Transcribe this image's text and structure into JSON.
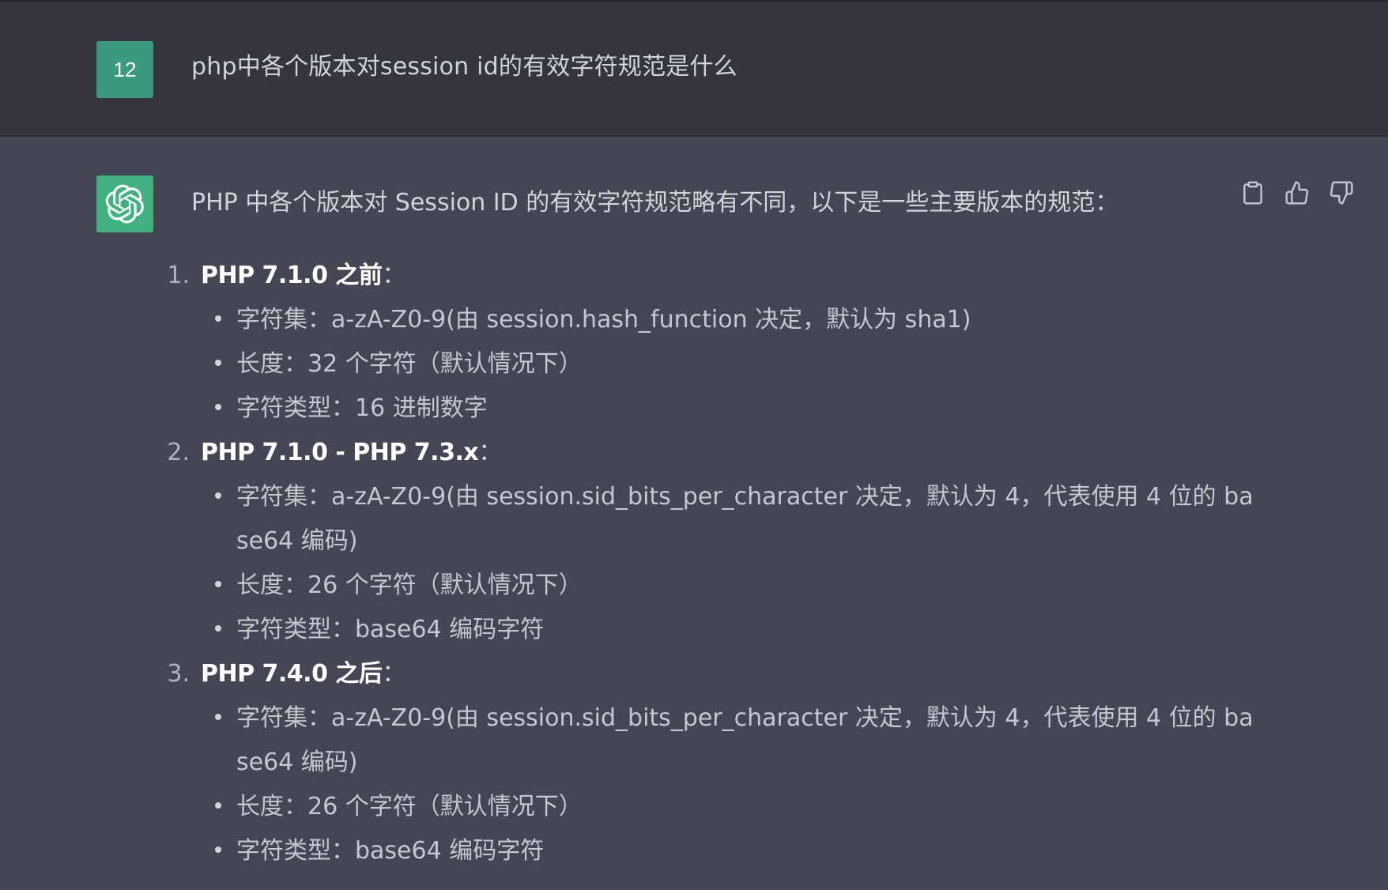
{
  "user_message": {
    "avatar_label": "12",
    "text": "php中各个版本对session id的有效字符规范是什么"
  },
  "assistant_message": {
    "avatar_icon": "openai-logo-icon",
    "intro": "PHP 中各个版本对 Session ID 的有效字符规范略有不同，以下是一些主要版本的规范：",
    "actions": {
      "copy": "copy-icon",
      "thumbs_up": "thumbs-up-icon",
      "thumbs_down": "thumbs-down-icon"
    },
    "sections": [
      {
        "number": "1.",
        "title": "PHP 7.1.0 之前",
        "colon": "：",
        "items": [
          "字符集：a-zA-Z0-9(由 session.hash_function 决定，默认为 sha1)",
          "长度：32 个字符（默认情况下）",
          "字符类型：16 进制数字"
        ]
      },
      {
        "number": "2.",
        "title": "PHP 7.1.0 - PHP 7.3.x",
        "colon": "：",
        "items": [
          "字符集：a-zA-Z0-9(由 session.sid_bits_per_character 决定，默认为 4，代表使用 4 位的 base64 编码)",
          "长度：26 个字符（默认情况下）",
          "字符类型：base64 编码字符"
        ]
      },
      {
        "number": "3.",
        "title": "PHP 7.4.0 之后",
        "colon": "：",
        "items": [
          "字符集：a-zA-Z0-9(由 session.sid_bits_per_character 决定，默认为 4，代表使用 4 位的 base64 编码)",
          "长度：26 个字符（默认情况下）",
          "字符类型：base64 编码字符"
        ]
      }
    ]
  },
  "colors": {
    "user_bg": "#343541",
    "assistant_bg": "#444654",
    "user_avatar": "#3a9a7f",
    "gpt_avatar": "#3fb27f",
    "text": "#d1d5db"
  }
}
